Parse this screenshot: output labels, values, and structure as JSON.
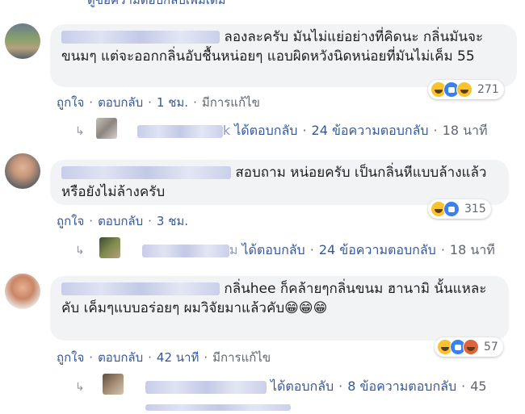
{
  "top_text": "ดูข้อความตอบกลับเพิ่มเติม",
  "comments": [
    {
      "text": "ลองละครับ มันไม่แย่อย่างที่คิดนะ กลิ่นมันจะขนมๆ แต่จะออกกลิ่นอับชื้นหน่อยๆ แอบผิดหวังนิดหน่อยที่มันไม่เค็ม 55",
      "actions": {
        "like": "ถูกใจ",
        "reply": "ตอบกลับ",
        "time": "1 ชม.",
        "edited": "มีการแก้ไข"
      },
      "reactions": {
        "icons": [
          "haha-icon",
          "like-icon",
          "wow-icon"
        ],
        "count": "271"
      },
      "reply_summary": {
        "name_suffix": "k",
        "replied": "ได้ตอบกลับ",
        "replies": "24 ข้อความตอบกลับ",
        "time": "18 นาที"
      }
    },
    {
      "text": "สอบถาม หน่อยครับ เป็นกลิ่นหีแบบล้างแล้วหรือยังไม่ล้างครับ",
      "actions": {
        "like": "ถูกใจ",
        "reply": "ตอบกลับ",
        "time": "3 ชม."
      },
      "reactions": {
        "icons": [
          "haha-icon",
          "like-icon"
        ],
        "count": "315"
      },
      "reply_summary": {
        "name_suffix": "ม",
        "replied": "ได้ตอบกลับ",
        "replies": "24 ข้อความตอบกลับ",
        "time": "18 นาที"
      }
    },
    {
      "text": "กลิ่นhee ก็คล้ายๆกลิ่นขนม ฮานามิ นั้นแหละคับ เค็มๆแบบอร่อยๆ ผมวิจัยมาแล้วคับ😁😁😁",
      "actions": {
        "like": "ถูกใจ",
        "reply": "ตอบกลับ",
        "time": "42 นาที",
        "edited": "มีการแก้ไข"
      },
      "reactions": {
        "icons": [
          "haha-icon",
          "like-icon",
          "angry-icon"
        ],
        "count": "57"
      },
      "reply_summary": {
        "replied": "ได้ตอบกลับ",
        "replies": "8 ข้อความตอบกลับ",
        "time": "45"
      }
    }
  ]
}
